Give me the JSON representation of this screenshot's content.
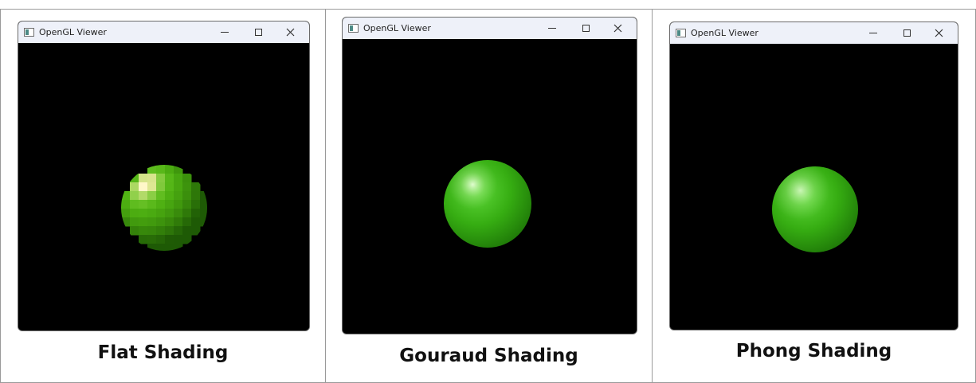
{
  "panels": [
    {
      "window_title": "OpenGL Viewer",
      "caption": "Flat Shading",
      "sphere_color": "#33aa11",
      "shading": "flat"
    },
    {
      "window_title": "OpenGL Viewer",
      "caption": "Gouraud Shading",
      "sphere_color": "#33aa11",
      "shading": "gouraud"
    },
    {
      "window_title": "OpenGL Viewer",
      "caption": "Phong Shading",
      "sphere_color": "#33aa11",
      "shading": "phong"
    }
  ],
  "icons": {
    "app": "app-window-icon",
    "minimize": "minimize-icon",
    "maximize": "maximize-icon",
    "close": "close-icon"
  },
  "colors": {
    "titlebar_bg": "#eef1f9",
    "viewport_bg": "#000000",
    "border": "#9a9a9a"
  }
}
